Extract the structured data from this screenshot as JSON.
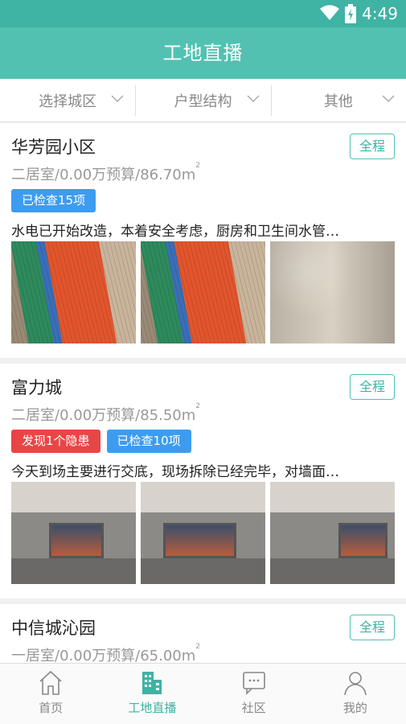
{
  "status_bar": {
    "time": "4:49"
  },
  "header": {
    "title": "工地直播"
  },
  "filters": [
    {
      "label": "选择城区"
    },
    {
      "label": "户型结构"
    },
    {
      "label": "其他"
    }
  ],
  "cards": [
    {
      "title": "华芳园小区",
      "tag": "全程",
      "subtitle": "二居室/0.00万预算/86.70m",
      "badges": [
        {
          "text": "已检查15项",
          "color": "#3d9cf0"
        }
      ],
      "description": "水电已开始改造，本着安全考虑，厨房和卫生间水管…"
    },
    {
      "title": "富力城",
      "tag": "全程",
      "subtitle": "二居室/0.00万预算/85.50m",
      "badges": [
        {
          "text": "发现1个隐患",
          "color": "#e84646"
        },
        {
          "text": "已检查10项",
          "color": "#3d9cf0"
        }
      ],
      "description": "今天到场主要进行交底，现场拆除已经完毕，对墙面…"
    },
    {
      "title": "中信城沁园",
      "tag": "全程",
      "subtitle": "一居室/0.00万预算/65.00m"
    }
  ],
  "tabs": [
    {
      "label": "首页",
      "icon": "home-icon"
    },
    {
      "label": "工地直播",
      "icon": "building-icon"
    },
    {
      "label": "社区",
      "icon": "community-icon"
    },
    {
      "label": "我的",
      "icon": "user-icon"
    }
  ],
  "colors": {
    "accent": "#52c1b2",
    "badge_blue": "#3d9cf0",
    "badge_red": "#e84646"
  }
}
